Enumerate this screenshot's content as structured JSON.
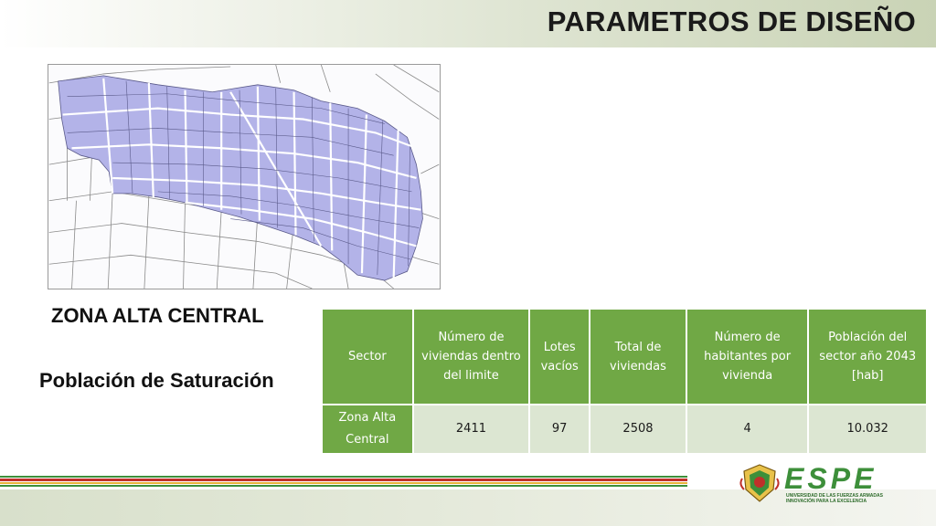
{
  "slide": {
    "title": "PARAMETROS DE DISEÑO",
    "zone_heading": "ZONA ALTA CENTRAL",
    "zone_subheading": "Población de Saturación"
  },
  "table": {
    "headers": [
      "Sector",
      "Número de viviendas dentro del limite",
      "Lotes vacíos",
      "Total de viviendas",
      "Número de habitantes por vivienda",
      "Población del sector año 2043 [hab]"
    ],
    "rows": [
      {
        "sector": "Zona Alta Central",
        "viviendas_limite": "2411",
        "lotes_vacios": "97",
        "total_viviendas": "2508",
        "habitantes_vivienda": "4",
        "poblacion_2043": "10.032"
      }
    ]
  },
  "logo": {
    "wordmark": "ESPE",
    "line1": "UNIVERSIDAD DE LAS FUERZAS ARMADAS",
    "line2": "INNOVACIÓN PARA LA EXCELENCIA"
  },
  "colors": {
    "table_header_green": "#70a845",
    "table_cell_light": "#dce6d2",
    "map_fill": "#b3b3e8",
    "stripe_red": "#c0302a",
    "stripe_green": "#3d8f3a"
  }
}
